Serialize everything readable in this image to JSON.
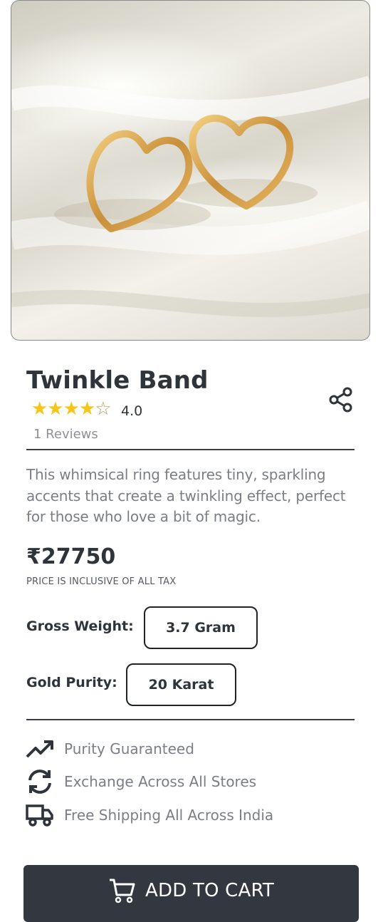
{
  "product": {
    "image_alt": "Gold heart-shaped hoop earrings on white satin",
    "title": "Twinkle Band",
    "rating_stars": "★★★★",
    "rating_empty": "☆",
    "rating": "4.0",
    "reviews": "1 Reviews",
    "description": "This whimsical ring features tiny, sparkling accents that create a twinkling effect, perfect for those who love a bit of magic.",
    "price": "₹27750",
    "tax_note": "PRICE IS INCLUSIVE OF ALL TAX"
  },
  "specs": {
    "gross_weight_label": "Gross Weight:",
    "gross_weight_value": "3.7 Gram",
    "gold_purity_label": "Gold Purity:",
    "gold_purity_value": "20 Karat"
  },
  "features": [
    {
      "icon": "trending-up-icon",
      "label": "Purity Guaranteed"
    },
    {
      "icon": "exchange-icon",
      "label": "Exchange Across All Stores"
    },
    {
      "icon": "truck-icon",
      "label": "Free Shipping All Across India"
    }
  ],
  "cart": {
    "label": "ADD TO CART",
    "icon": "cart-icon"
  },
  "colors": {
    "accent": "#323740",
    "star": "#f5c518",
    "text": "#2f333a",
    "muted": "#7b7e84"
  }
}
